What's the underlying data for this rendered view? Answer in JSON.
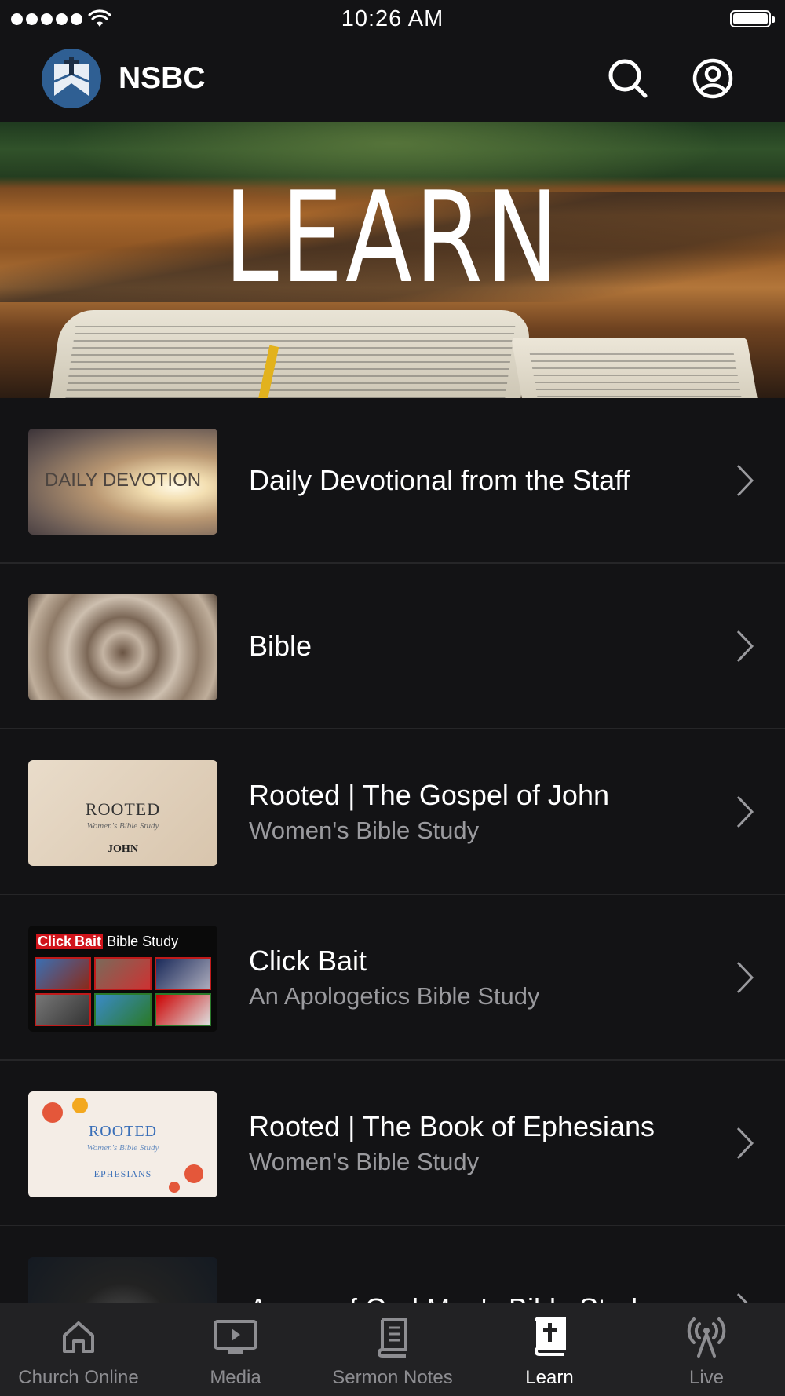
{
  "status_bar": {
    "time": "10:26 AM"
  },
  "header": {
    "title": "NSBC"
  },
  "hero": {
    "title": "LEARN"
  },
  "items": [
    {
      "title": "Daily Devotional from the Staff",
      "subtitle": "",
      "thumb_text": "DAILY DEVOTION"
    },
    {
      "title": "Bible",
      "subtitle": ""
    },
    {
      "title": "Rooted | The Gospel of John",
      "subtitle": "Women's Bible Study",
      "thumb_text": [
        "ROOTED",
        "Women's Bible Study",
        "JOHN"
      ]
    },
    {
      "title": "Click Bait",
      "subtitle": "An Apologetics Bible Study",
      "thumb_text": [
        "Click",
        "Bait",
        "Bible Study"
      ]
    },
    {
      "title": "Rooted | The Book of Ephesians",
      "subtitle": "Women's Bible Study",
      "thumb_text": [
        "ROOTED",
        "Women's Bible Study",
        "EPHESIANS"
      ]
    },
    {
      "title": "Armor of God Men's Bible Study",
      "subtitle": ""
    }
  ],
  "tabs": [
    {
      "label": "Church Online",
      "icon": "home-icon",
      "active": false
    },
    {
      "label": "Media",
      "icon": "play-screen-icon",
      "active": false
    },
    {
      "label": "Sermon Notes",
      "icon": "notes-book-icon",
      "active": false
    },
    {
      "label": "Learn",
      "icon": "bible-icon",
      "active": true
    },
    {
      "label": "Live",
      "icon": "broadcast-icon",
      "active": false
    }
  ],
  "colors": {
    "background": "#131315",
    "tabbar": "#222224",
    "inactive": "#8d8d91",
    "active": "#ffffff",
    "logo": "#2f5f93"
  }
}
